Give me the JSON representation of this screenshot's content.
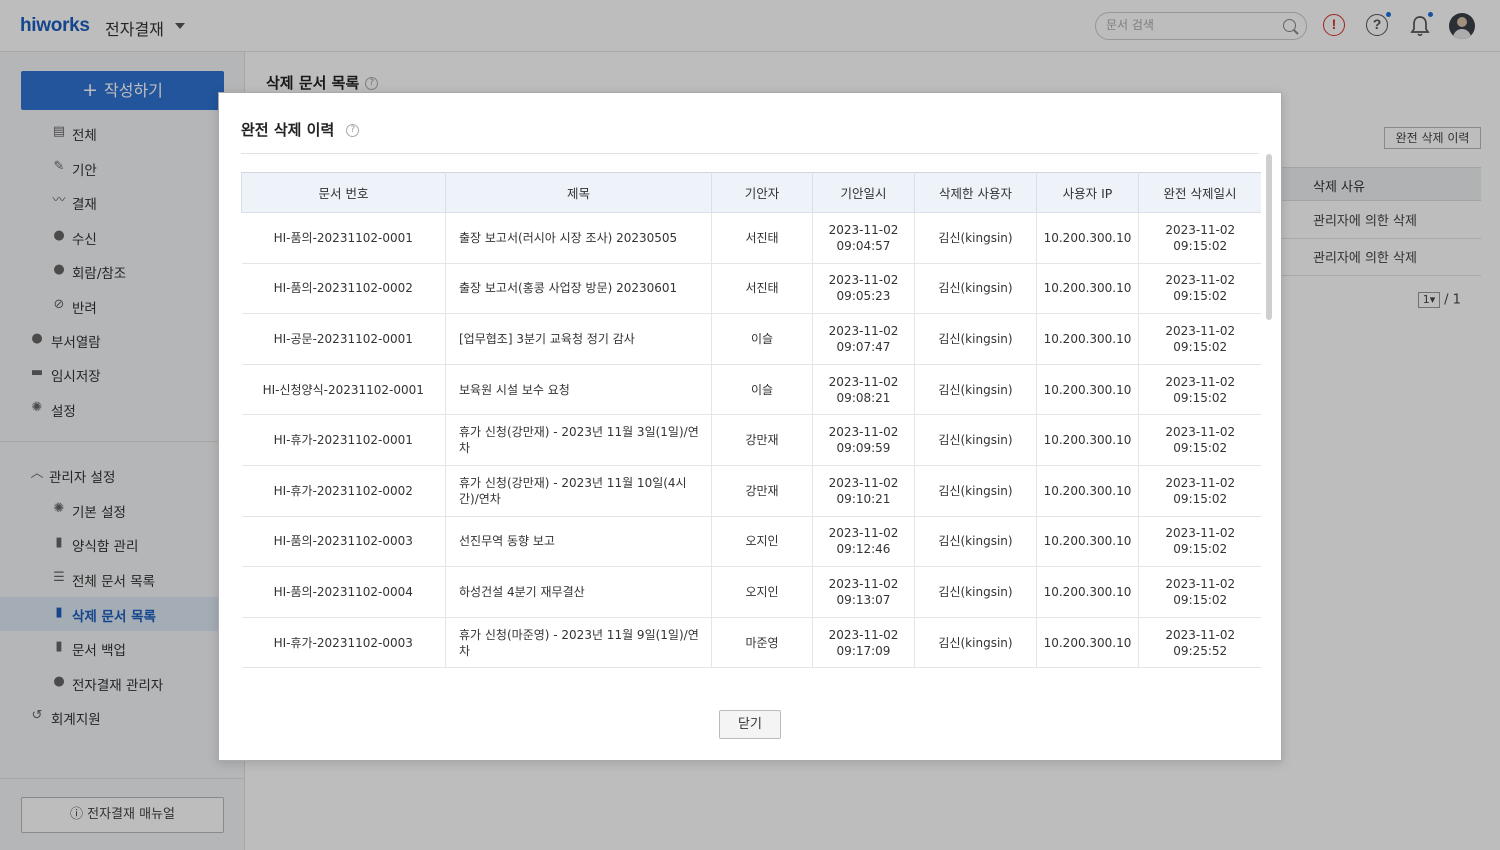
{
  "header": {
    "logo": "hiworks",
    "app_name": "전자결재",
    "search_placeholder": "문서 검색"
  },
  "sidebar": {
    "write_button": "작성하기",
    "items": [
      {
        "label": "전체",
        "icon": "document-stack-icon",
        "glyph": "▤"
      },
      {
        "label": "기안",
        "icon": "pencil-icon",
        "glyph": "✎"
      },
      {
        "label": "결재",
        "icon": "signature-icon",
        "glyph": "〰"
      },
      {
        "label": "수신",
        "icon": "person-icon",
        "glyph": "●"
      },
      {
        "label": "회람/참조",
        "icon": "people-icon",
        "glyph": "●"
      },
      {
        "label": "반려",
        "icon": "ban-icon",
        "glyph": "⊘"
      },
      {
        "label": "부서열람",
        "icon": "group-icon",
        "glyph": "●"
      },
      {
        "label": "임시저장",
        "icon": "folder-icon",
        "glyph": "▬"
      },
      {
        "label": "설정",
        "icon": "gear-icon",
        "glyph": "✺"
      }
    ],
    "admin_section": "관리자 설정",
    "admin_items": [
      {
        "label": "기본 설정",
        "icon": "gear-icon",
        "glyph": "✺"
      },
      {
        "label": "양식함 관리",
        "icon": "file-icon",
        "glyph": "▮"
      },
      {
        "label": "전체 문서 목록",
        "icon": "list-icon",
        "glyph": "☰"
      },
      {
        "label": "삭제 문서 목록",
        "icon": "trash-icon",
        "glyph": "▮"
      },
      {
        "label": "문서 백업",
        "icon": "backup-file-icon",
        "glyph": "▮"
      },
      {
        "label": "전자결재 관리자",
        "icon": "admin-user-icon",
        "glyph": "●"
      }
    ],
    "accounting": "회계지원",
    "manual_button": "전자결재 매뉴얼"
  },
  "main": {
    "title": "삭제 문서 목록",
    "purge_history_button": "완전 삭제 이력",
    "reason_header": "삭제 사유",
    "reasons": [
      "관리자에 의한 삭제",
      "관리자에 의한 삭제"
    ],
    "pager_current": "1",
    "pager_total": "/ 1"
  },
  "modal": {
    "title": "완전 삭제 이력",
    "columns": [
      "문서 번호",
      "제목",
      "기안자",
      "기안일시",
      "삭제한 사용자",
      "사용자 IP",
      "완전 삭제일시"
    ],
    "rows": [
      {
        "doc_no": "HI-품의-20231102-0001",
        "title": "출장 보고서(러시아 시장 조사) 20230505",
        "drafter": "서진태",
        "draft_date": "2023-11-02",
        "draft_time": "09:04:57",
        "deleter": "김신(kingsin)",
        "ip": "10.200.300.10",
        "purge_date": "2023-11-02",
        "purge_time": "09:15:02"
      },
      {
        "doc_no": "HI-품의-20231102-0002",
        "title": "출장 보고서(홍콩 사업장 방문) 20230601",
        "drafter": "서진태",
        "draft_date": "2023-11-02",
        "draft_time": "09:05:23",
        "deleter": "김신(kingsin)",
        "ip": "10.200.300.10",
        "purge_date": "2023-11-02",
        "purge_time": "09:15:02"
      },
      {
        "doc_no": "HI-공문-20231102-0001",
        "title": "[업무협조] 3분기 교육청 정기 감사",
        "drafter": "이슬",
        "draft_date": "2023-11-02",
        "draft_time": "09:07:47",
        "deleter": "김신(kingsin)",
        "ip": "10.200.300.10",
        "purge_date": "2023-11-02",
        "purge_time": "09:15:02"
      },
      {
        "doc_no": "HI-신청양식-20231102-0001",
        "title": "보육원 시설 보수 요청",
        "drafter": "이슬",
        "draft_date": "2023-11-02",
        "draft_time": "09:08:21",
        "deleter": "김신(kingsin)",
        "ip": "10.200.300.10",
        "purge_date": "2023-11-02",
        "purge_time": "09:15:02"
      },
      {
        "doc_no": "HI-휴가-20231102-0001",
        "title": "휴가 신청(강만재) - 2023년 11월 3일(1일)/연차",
        "drafter": "강만재",
        "draft_date": "2023-11-02",
        "draft_time": "09:09:59",
        "deleter": "김신(kingsin)",
        "ip": "10.200.300.10",
        "purge_date": "2023-11-02",
        "purge_time": "09:15:02"
      },
      {
        "doc_no": "HI-휴가-20231102-0002",
        "title": "휴가 신청(강만재) - 2023년 11월 10일(4시간)/연차",
        "drafter": "강만재",
        "draft_date": "2023-11-02",
        "draft_time": "09:10:21",
        "deleter": "김신(kingsin)",
        "ip": "10.200.300.10",
        "purge_date": "2023-11-02",
        "purge_time": "09:15:02"
      },
      {
        "doc_no": "HI-품의-20231102-0003",
        "title": "선진무역 동향 보고",
        "drafter": "오지인",
        "draft_date": "2023-11-02",
        "draft_time": "09:12:46",
        "deleter": "김신(kingsin)",
        "ip": "10.200.300.10",
        "purge_date": "2023-11-02",
        "purge_time": "09:15:02"
      },
      {
        "doc_no": "HI-품의-20231102-0004",
        "title": "하성건설 4분기 재무결산",
        "drafter": "오지인",
        "draft_date": "2023-11-02",
        "draft_time": "09:13:07",
        "deleter": "김신(kingsin)",
        "ip": "10.200.300.10",
        "purge_date": "2023-11-02",
        "purge_time": "09:15:02"
      },
      {
        "doc_no": "HI-휴가-20231102-0003",
        "title": "휴가 신청(마준영) - 2023년 11월 9일(1일)/연차",
        "drafter": "마준영",
        "draft_date": "2023-11-02",
        "draft_time": "09:17:09",
        "deleter": "김신(kingsin)",
        "ip": "10.200.300.10",
        "purge_date": "2023-11-02",
        "purge_time": "09:25:52"
      }
    ],
    "close_button": "닫기"
  },
  "colors": {
    "brand": "#1d5fbf",
    "primary_button": "#2f73d3",
    "alert": "#d9302c",
    "table_header": "#eef3fa"
  }
}
